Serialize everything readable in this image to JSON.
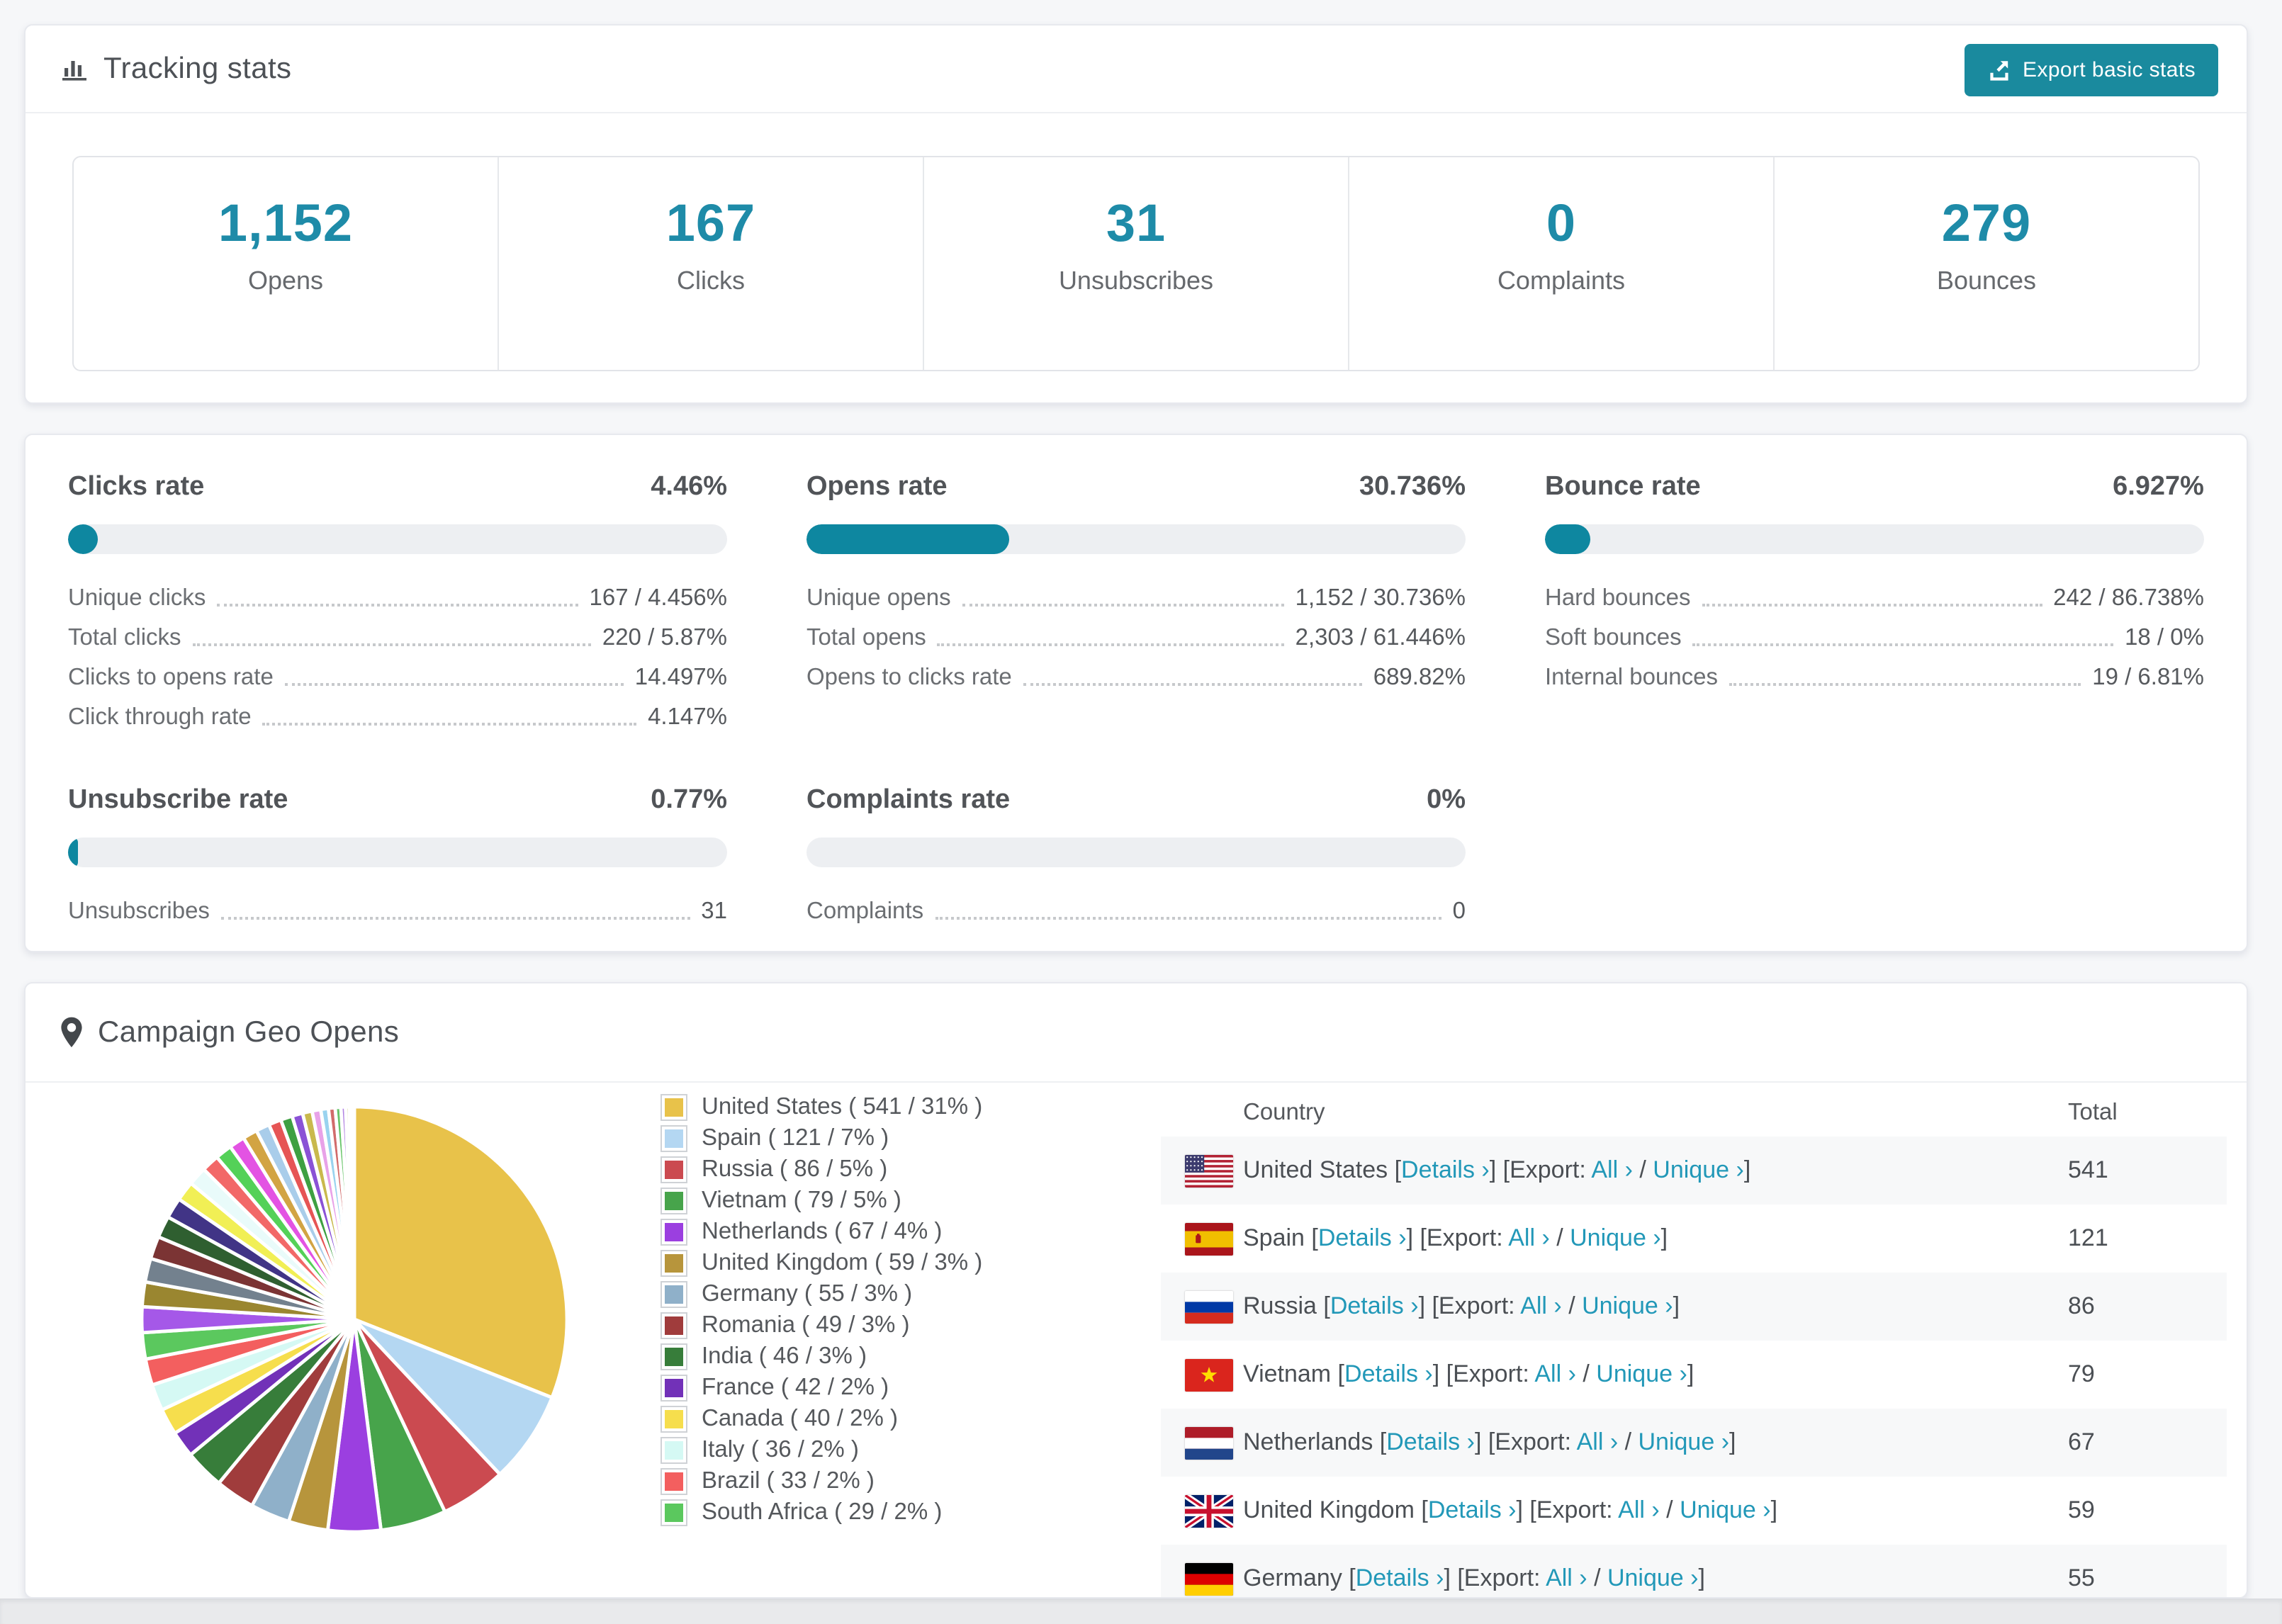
{
  "colors": {
    "accent_teal": "#1a8a9e",
    "stat_number": "#1e8ba8",
    "bar_fill": "#0e87a0",
    "link": "#2298b8"
  },
  "header": {
    "title": "Tracking stats",
    "export_label": "Export basic stats"
  },
  "summary": [
    {
      "value": "1,152",
      "label": "Opens"
    },
    {
      "value": "167",
      "label": "Clicks"
    },
    {
      "value": "31",
      "label": "Unsubscribes"
    },
    {
      "value": "0",
      "label": "Complaints"
    },
    {
      "value": "279",
      "label": "Bounces"
    }
  ],
  "rates": {
    "order": [
      "clicks",
      "opens",
      "bounce",
      "unsubscribe",
      "complaints"
    ],
    "clicks": {
      "title": "Clicks rate",
      "value": "4.46%",
      "pct": 4.46,
      "rows": [
        [
          "Unique clicks",
          "167 / 4.456%"
        ],
        [
          "Total clicks",
          "220 / 5.87%"
        ],
        [
          "Clicks to opens rate",
          "14.497%"
        ],
        [
          "Click through rate",
          "4.147%"
        ]
      ]
    },
    "opens": {
      "title": "Opens rate",
      "value": "30.736%",
      "pct": 30.736,
      "rows": [
        [
          "Unique opens",
          "1,152 / 30.736%"
        ],
        [
          "Total opens",
          "2,303 / 61.446%"
        ],
        [
          "Opens to clicks rate",
          "689.82%"
        ]
      ]
    },
    "bounce": {
      "title": "Bounce rate",
      "value": "6.927%",
      "pct": 6.927,
      "rows": [
        [
          "Hard bounces",
          "242 / 86.738%"
        ],
        [
          "Soft bounces",
          "18 / 0%"
        ],
        [
          "Internal bounces",
          "19 / 6.81%"
        ]
      ]
    },
    "unsubscribe": {
      "title": "Unsubscribe rate",
      "value": "0.77%",
      "pct": 0.77,
      "rows": [
        [
          "Unsubscribes",
          "31"
        ]
      ]
    },
    "complaints": {
      "title": "Complaints rate",
      "value": "0%",
      "pct": 0,
      "rows": [
        [
          "Complaints",
          "0"
        ]
      ]
    }
  },
  "geo": {
    "title": "Campaign Geo Opens",
    "table": {
      "headers": [
        "Country",
        "Total"
      ],
      "link_labels": {
        "details": "Details",
        "export_prefix": "Export:",
        "all": "All",
        "unique": "Unique",
        "arrow": "›"
      },
      "rows": [
        {
          "country": "United States",
          "flag": "us",
          "total": "541"
        },
        {
          "country": "Spain",
          "flag": "es",
          "total": "121"
        },
        {
          "country": "Russia",
          "flag": "ru",
          "total": "86"
        },
        {
          "country": "Vietnam",
          "flag": "vn",
          "total": "79"
        },
        {
          "country": "Netherlands",
          "flag": "nl",
          "total": "67"
        },
        {
          "country": "United Kingdom",
          "flag": "gb",
          "total": "59"
        },
        {
          "country": "Germany",
          "flag": "de",
          "total": "55"
        }
      ]
    }
  },
  "chart_data": {
    "type": "pie",
    "title": "Campaign Geo Opens",
    "unit": "opens",
    "legend_position": "right",
    "start_angle_deg": 0,
    "direction": "clockwise",
    "slices": [
      {
        "name": "United States",
        "opens": 541,
        "pct": 31,
        "color": "#e8c24a"
      },
      {
        "name": "Spain",
        "opens": 121,
        "pct": 7,
        "color": "#b4d7f2"
      },
      {
        "name": "Russia",
        "opens": 86,
        "pct": 5,
        "color": "#cb4a50"
      },
      {
        "name": "Vietnam",
        "opens": 79,
        "pct": 5,
        "color": "#47a44b"
      },
      {
        "name": "Netherlands",
        "opens": 67,
        "pct": 4,
        "color": "#9b3fe0"
      },
      {
        "name": "United Kingdom",
        "opens": 59,
        "pct": 3,
        "color": "#b7953c"
      },
      {
        "name": "Germany",
        "opens": 55,
        "pct": 3,
        "color": "#8fb0c9"
      },
      {
        "name": "Romania",
        "opens": 49,
        "pct": 3,
        "color": "#a03c3c"
      },
      {
        "name": "India",
        "opens": 46,
        "pct": 3,
        "color": "#377d3a"
      },
      {
        "name": "France",
        "opens": 42,
        "pct": 2,
        "color": "#7231b8"
      },
      {
        "name": "Canada",
        "opens": 40,
        "pct": 2,
        "color": "#f6de4d"
      },
      {
        "name": "Italy",
        "opens": 36,
        "pct": 2,
        "color": "#d5f9f4"
      },
      {
        "name": "Brazil",
        "opens": 33,
        "pct": 2,
        "color": "#f35f5f"
      },
      {
        "name": "South Africa",
        "opens": 29,
        "pct": 2,
        "color": "#5bc85e"
      }
    ],
    "others": {
      "combined_pct": 26,
      "slice_pcts": [
        1.95,
        1.87,
        1.8,
        1.72,
        1.65,
        1.57,
        1.49,
        1.42,
        1.34,
        1.27,
        1.19,
        1.11,
        1.04,
        0.96,
        0.89,
        0.81,
        0.73,
        0.66,
        0.58,
        0.51,
        0.43,
        0.35,
        0.28,
        0.2,
        0.13,
        0.05
      ],
      "colors": [
        "#a558e8",
        "#9a8630",
        "#73818e",
        "#7b3434",
        "#2f5f30",
        "#413486",
        "#f1ef55",
        "#e9fbfa",
        "#f26868",
        "#54d158",
        "#e353e3",
        "#d2a443",
        "#a9cdea",
        "#e65555",
        "#3ea042",
        "#8a52d6",
        "#c9b94d",
        "#e8a2e8",
        "#99d3ef",
        "#d16b6b",
        "#68c46a",
        "#b183e2",
        "#d2d285",
        "#f0c2f0",
        "#c2e2f2",
        "#de9292"
      ]
    }
  }
}
